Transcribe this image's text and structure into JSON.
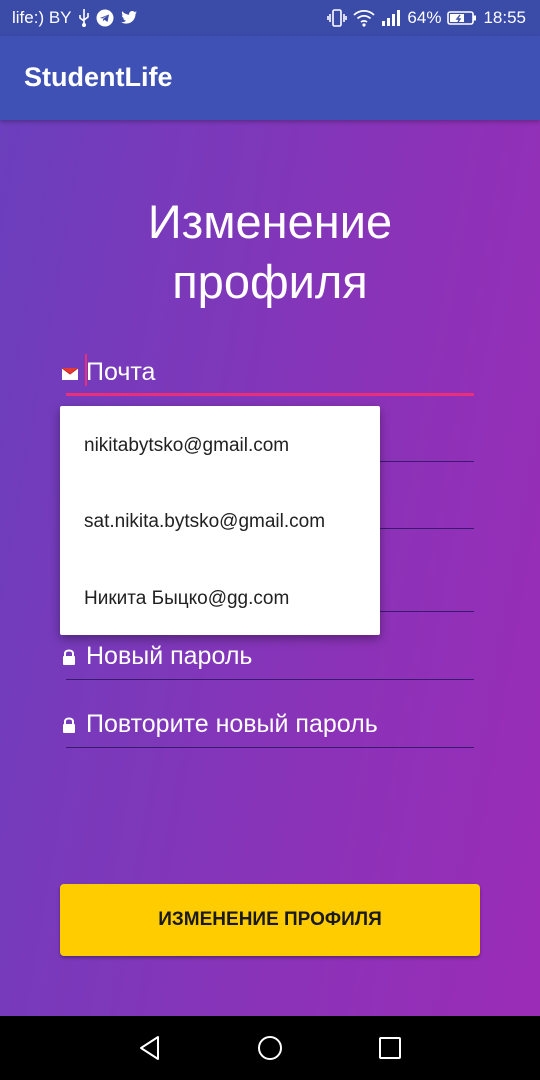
{
  "status_bar": {
    "carrier": "life:) BY",
    "battery_percent": "64%",
    "time": "18:55",
    "icons_left": [
      "usb-icon",
      "telegram-icon",
      "twitter-icon"
    ],
    "icons_right": [
      "vibrate-icon",
      "wifi-icon",
      "signal-icon",
      "battery-icon"
    ]
  },
  "app_bar": {
    "title": "StudentLife"
  },
  "heading": {
    "line1": "Изменение",
    "line2": "профиля"
  },
  "form": {
    "email": {
      "label": "Почта",
      "icon": "envelope-icon",
      "focused": true
    },
    "new_password": {
      "label": "Новый пароль",
      "icon": "lock-icon"
    },
    "repeat_password": {
      "label": "Повторите новый пароль",
      "icon": "lock-icon"
    }
  },
  "autocomplete": {
    "options": [
      "nikitabytsko@gmail.com",
      "sat.nikita.bytsko@gmail.com",
      "Никита Быцко@gg.com"
    ]
  },
  "submit_button": {
    "label": "ИЗМЕНЕНИЕ ПРОФИЛЯ"
  },
  "nav_bar": {
    "buttons": [
      "back-icon",
      "home-icon",
      "recents-icon"
    ]
  },
  "colors": {
    "app_bar": "#3f51b5",
    "gradient_start": "#6b3fbd",
    "gradient_end": "#9b2cb7",
    "accent": "#e8307a",
    "button": "#ffcc00"
  }
}
